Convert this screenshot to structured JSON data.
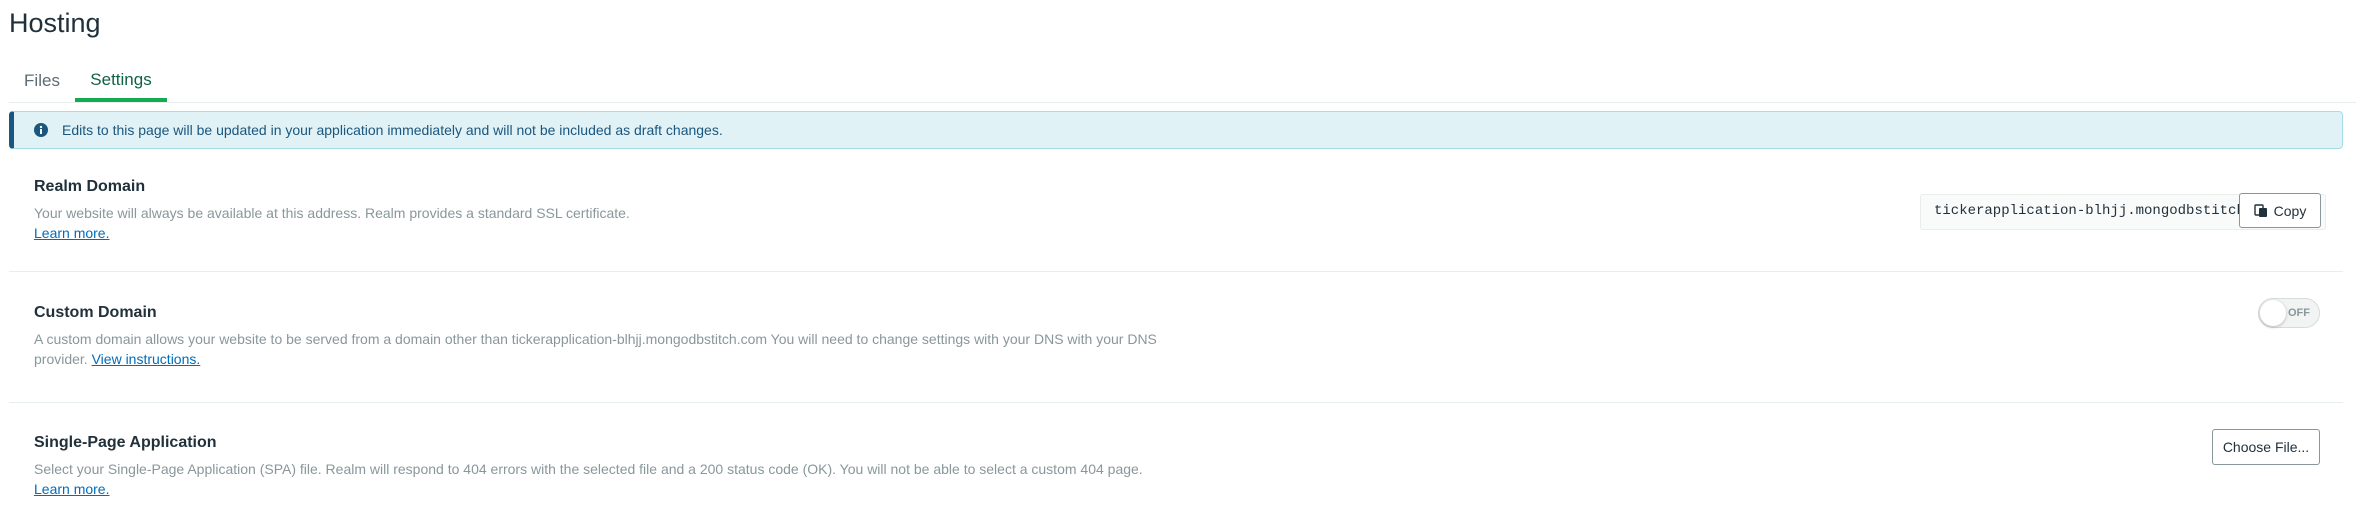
{
  "page": {
    "title": "Hosting"
  },
  "tabs": [
    {
      "label": "Files",
      "active": false
    },
    {
      "label": "Settings",
      "active": true
    }
  ],
  "banner": {
    "icon": "info-icon",
    "text": "Edits to this page will be updated in your application immediately and will not be included as draft changes."
  },
  "realm_domain": {
    "title": "Realm Domain",
    "description": "Your website will always be available at this address. Realm provides a standard SSL certificate.",
    "link": "Learn more.",
    "value": "tickerapplication-blhjj.mongodbstitch.com",
    "copy_label": "Copy",
    "copy_icon": "copy-icon"
  },
  "custom_domain": {
    "title": "Custom Domain",
    "description": "A custom domain allows your website to be served from a domain other than tickerapplication-blhjj.mongodbstitch.com You will need to change settings with your DNS with your DNS provider.",
    "link": "View instructions.",
    "toggle_label": "OFF",
    "enabled": false
  },
  "spa": {
    "title": "Single-Page Application",
    "description": "Select your Single-Page Application (SPA) file. Realm will respond to 404 errors with the selected file and a 200 status code (OK). You will not be able to select a custom 404 page.",
    "link": "Learn more.",
    "button_label": "Choose File..."
  },
  "colors": {
    "accent": "#13aa52",
    "link": "#006cbc",
    "banner_bg": "#e1f2f6",
    "banner_text": "#1a567e"
  }
}
